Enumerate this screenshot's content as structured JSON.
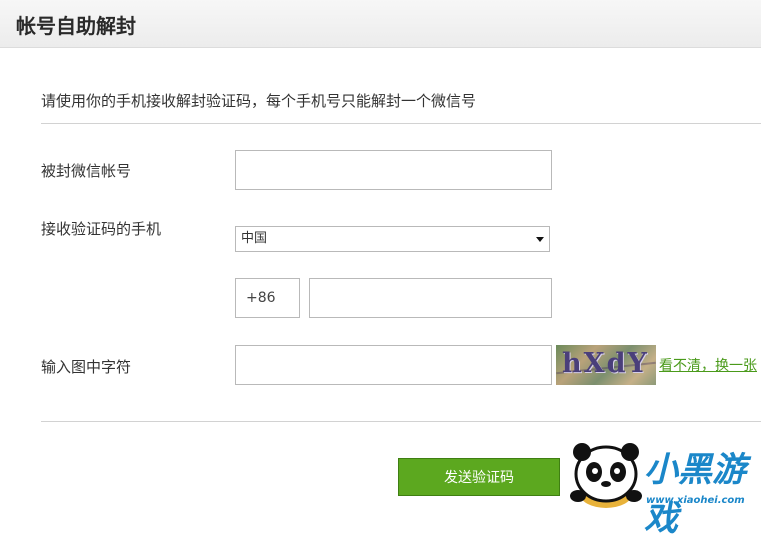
{
  "header": {
    "title": "帐号自助解封"
  },
  "intro": "请使用你的手机接收解封验证码，每个手机号只能解封一个微信号",
  "form": {
    "account_label": "被封微信帐号",
    "account_value": "",
    "phone_label": "接收验证码的手机",
    "country_value": "中国",
    "phone_prefix": "+86",
    "phone_value": "",
    "captcha_label": "输入图中字符",
    "captcha_value": "",
    "captcha_image_text": "hXdY",
    "refresh_link": "看不清，换一张"
  },
  "submit_label": "发送验证码",
  "watermark": {
    "text": "小黑游戏",
    "url": "www.xiaohei.com"
  },
  "colors": {
    "accent": "#5ca81f",
    "link": "#4a9a1a",
    "watermark": "#1b87c9"
  }
}
